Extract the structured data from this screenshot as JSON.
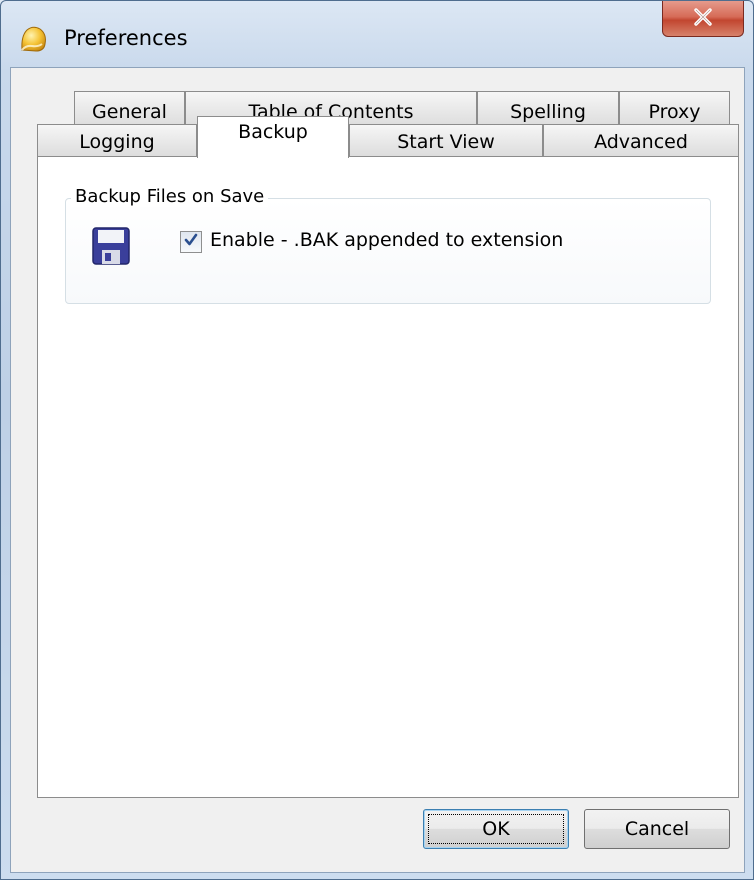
{
  "window": {
    "title": "Preferences"
  },
  "tabs": {
    "row1": [
      {
        "label": "General"
      },
      {
        "label": "Table of Contents"
      },
      {
        "label": "Spelling"
      },
      {
        "label": "Proxy"
      }
    ],
    "row2": [
      {
        "label": "Logging"
      },
      {
        "label": "Backup",
        "active": true
      },
      {
        "label": "Start View"
      },
      {
        "label": "Advanced"
      }
    ]
  },
  "backup": {
    "group_title": "Backup Files on Save",
    "enable_label": "Enable - .BAK appended to extension",
    "enable_checked": true,
    "icon": "floppy-disk-icon"
  },
  "buttons": {
    "ok": "OK",
    "cancel": "Cancel"
  },
  "colors": {
    "close_button": "#c9452f",
    "panel": "#ffffff",
    "dialog_bg": "#f0f0f0",
    "floppy": "#3a3f9b"
  }
}
